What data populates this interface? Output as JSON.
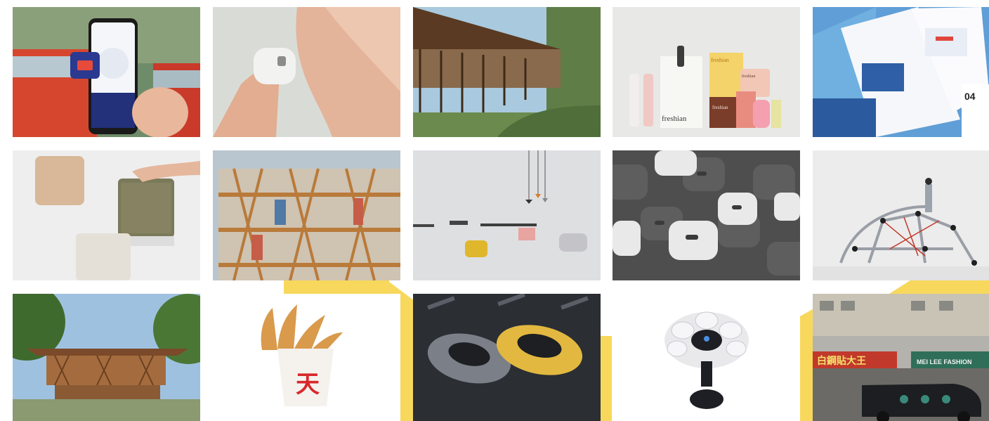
{
  "colors": {
    "background": "#ffffff",
    "accent_yellow": "#f7d85c"
  },
  "gallery": {
    "tiles": [
      {
        "id": "bus-app"
      },
      {
        "id": "skin-device"
      },
      {
        "id": "stilt-building"
      },
      {
        "id": "freshian-packaging",
        "text": {
          "brand": "freshian",
          "jar_brand": "freshian",
          "box_brand": "freshian",
          "top_box": "freshian"
        }
      },
      {
        "id": "illustrated-book",
        "text": {
          "page_number": "04"
        }
      },
      {
        "id": "air-purifiers"
      },
      {
        "id": "timber-facade"
      },
      {
        "id": "furniture-set"
      },
      {
        "id": "dark-grey-devices"
      },
      {
        "id": "playground"
      },
      {
        "id": "wooden-pavilion"
      },
      {
        "id": "fries-packaging",
        "text": {
          "logo_mark": "天"
        }
      },
      {
        "id": "cars-top-view"
      },
      {
        "id": "adaptive-controller"
      },
      {
        "id": "street-scene",
        "text": {
          "sign_left": "白鋼貼大王",
          "sign_right": "MEI LEE FASHION"
        }
      }
    ]
  }
}
